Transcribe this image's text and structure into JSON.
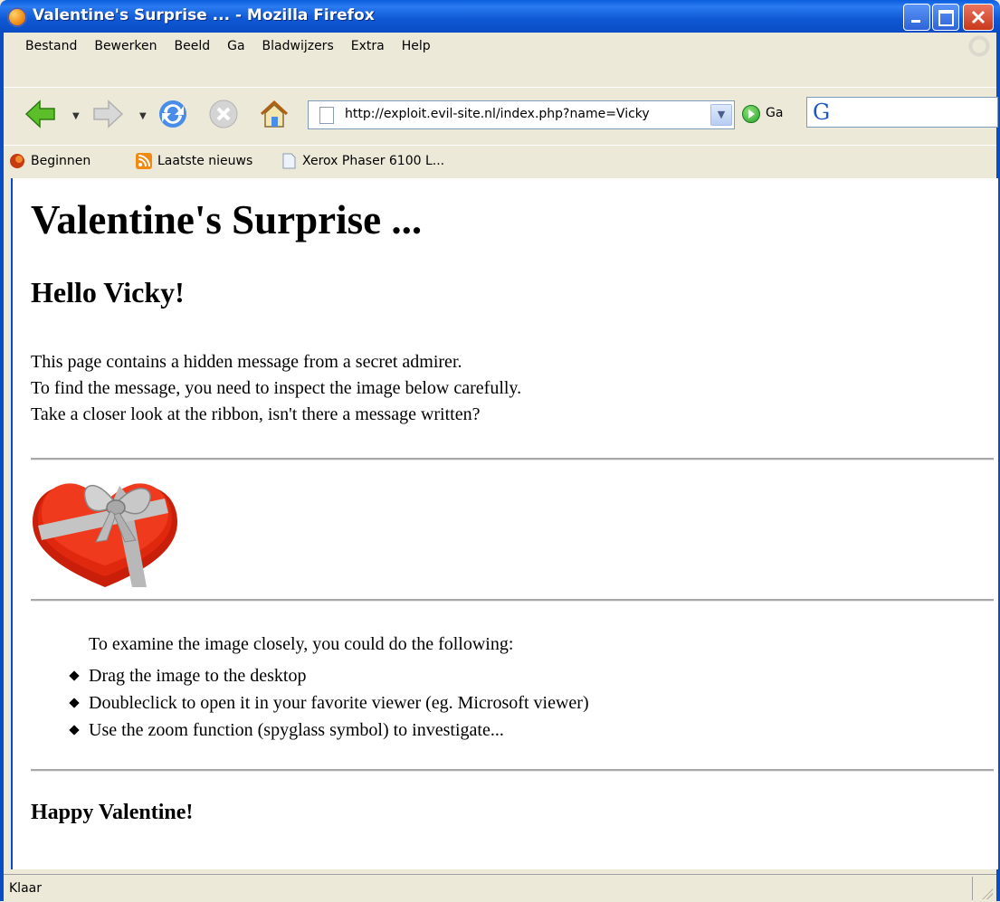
{
  "window": {
    "title": "Valentine's Surprise ... - Mozilla Firefox"
  },
  "menu": {
    "items": [
      "Bestand",
      "Bewerken",
      "Beeld",
      "Ga",
      "Bladwijzers",
      "Extra",
      "Help"
    ]
  },
  "toolbar": {
    "back_icon": "back-arrow-icon",
    "forward_icon": "forward-arrow-icon",
    "reload_icon": "reload-icon",
    "stop_icon": "stop-icon",
    "home_icon": "home-icon",
    "url": "http://exploit.evil-site.nl/index.php?name=Vicky",
    "go_label": "Ga",
    "search_engine_icon": "google-icon",
    "search_value": ""
  },
  "bookmarks": {
    "items": [
      {
        "label": "Beginnen",
        "icon": "firefox-bookmark-icon"
      },
      {
        "label": "Laatste nieuws",
        "icon": "rss-feed-icon"
      },
      {
        "label": "Xerox Phaser 6100 L...",
        "icon": "page-icon"
      }
    ]
  },
  "page": {
    "heading": "Valentine's Surprise ...",
    "greeting": "Hello Vicky!",
    "intro_lines": [
      "This page contains a hidden message from a secret admirer.",
      "To find the message, you need to inspect the image below carefully.",
      "Take a closer look at the ribbon, isn't there a message written?"
    ],
    "image_icon": "heart-gift-box-image",
    "instructions_intro": "To examine the image closely, you could do the following:",
    "instructions": [
      "Drag the image to the desktop",
      "Doubleclick to open it in your favorite viewer (eg. Microsoft viewer)",
      "Use the zoom function (spyglass symbol) to investigate..."
    ],
    "closing": "Happy Valentine!"
  },
  "status": {
    "text": "Klaar"
  }
}
